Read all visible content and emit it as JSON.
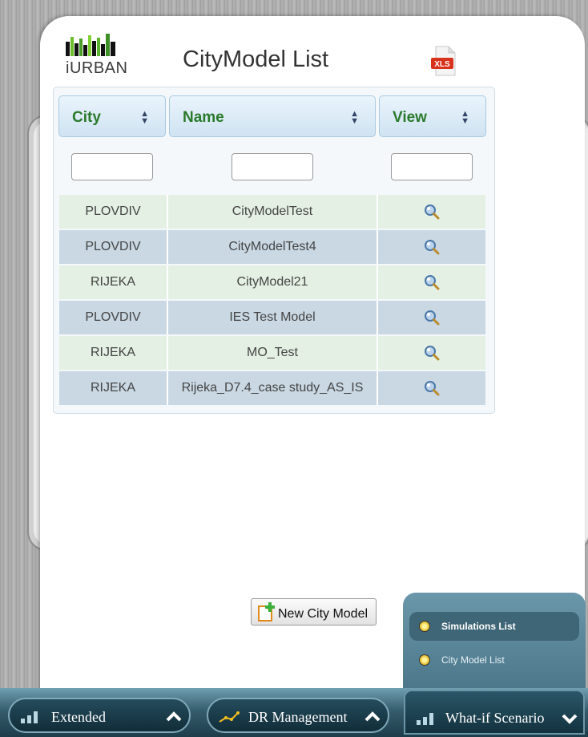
{
  "app": {
    "logo_text": "iURBAN",
    "title": "CityModel List",
    "export_icon_text": "XLS"
  },
  "table": {
    "columns": [
      {
        "label": "City"
      },
      {
        "label": "Name"
      },
      {
        "label": "View"
      }
    ],
    "filters": {
      "city": "",
      "name": "",
      "view": ""
    },
    "rows": [
      {
        "city": "PLOVDIV",
        "name": "CityModelTest"
      },
      {
        "city": "PLOVDIV",
        "name": "CityModelTest4"
      },
      {
        "city": "RIJEKA",
        "name": "CityModel21"
      },
      {
        "city": "PLOVDIV",
        "name": "IES Test Model"
      },
      {
        "city": "RIJEKA",
        "name": "MO_Test"
      },
      {
        "city": "RIJEKA",
        "name": "Rijeka_D7.4_case study_AS_IS"
      }
    ]
  },
  "actions": {
    "new_city_model": "New City Model"
  },
  "popup_menu": {
    "items": [
      {
        "label": "Simulations List",
        "selected": true
      },
      {
        "label": "City Model List",
        "selected": false
      }
    ]
  },
  "taskbar": {
    "items": [
      {
        "label": "Extended"
      },
      {
        "label": "DR Management"
      },
      {
        "label": "What-if Scenario"
      }
    ]
  },
  "colors": {
    "header_text": "#2b7a2b",
    "row_light": "#e4f0e3",
    "row_dark": "#c9d8e3",
    "taskbar": "#1e3d4a"
  }
}
